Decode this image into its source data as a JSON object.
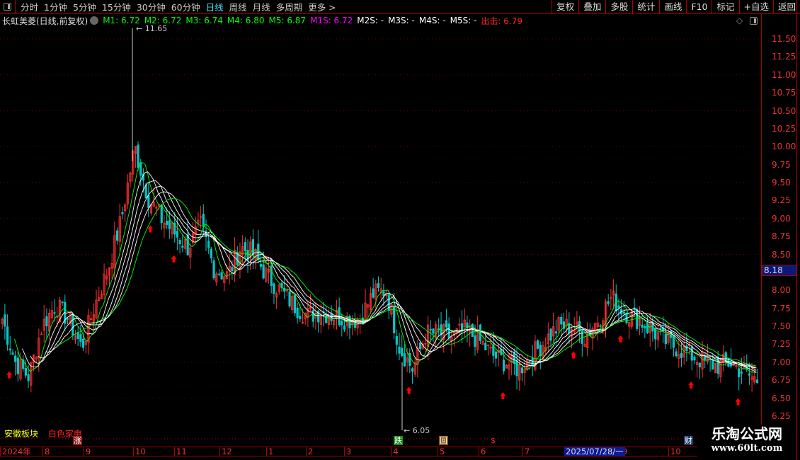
{
  "toolbar": {
    "periods": [
      "分时",
      "1分钟",
      "5分钟",
      "15分钟",
      "30分钟",
      "60分钟",
      "日线",
      "周线",
      "月线",
      "多周期",
      "更多 >"
    ],
    "active": "日线",
    "buttons": [
      "复权",
      "叠加",
      "多股",
      "统计",
      "画线",
      "F10",
      "标记",
      "+自选",
      "返回"
    ]
  },
  "info": {
    "title": "长虹美菱(日线,前复权)",
    "m1": "M1: 6.72",
    "m2": "M2: 6.72",
    "m3": "M3: 6.74",
    "m4": "M4: 6.80",
    "m5": "M5: 6.87",
    "m1s": "M1S: 6.72",
    "m2s": "M2S: -",
    "m3s": "M3S: -",
    "m4s": "M4S: -",
    "m5s": "M5S: -",
    "chuji": "出击: 6.79"
  },
  "price_axis": {
    "ticks": [
      "11.50",
      "11.25",
      "11.00",
      "10.75",
      "10.50",
      "10.25",
      "10.00",
      "9.75",
      "9.50",
      "9.25",
      "9.00",
      "8.75",
      "8.50",
      "8.00",
      "7.75",
      "7.50",
      "7.25",
      "7.00",
      "6.75",
      "6.50",
      "6.25"
    ],
    "current": "8.18"
  },
  "annotations": {
    "high": "11.65",
    "low": "6.05"
  },
  "bottom": {
    "sector": "安徽板块",
    "concept": "白色家电"
  },
  "markers": [
    {
      "text": "涨",
      "color": "#8b1a1a"
    },
    {
      "text": "跌",
      "color": "#1a8a1a"
    },
    {
      "text": "回",
      "color": "#8a5a1a"
    },
    {
      "text": "$",
      "color": "#000"
    },
    {
      "text": "财",
      "color": "#1a3a6a"
    }
  ],
  "time_axis": [
    "2024年",
    "8",
    "9",
    "10",
    "11",
    "12",
    "1",
    "2",
    "3",
    "4",
    "5",
    "6",
    "7",
    "9",
    "10"
  ],
  "selected_date": "2025/07/28/一",
  "colors": {
    "up": "#ff3030",
    "down": "#00c8c8",
    "ma_green": "#00ff00",
    "ma_white": "#ffffff",
    "signal": "#ff0000",
    "accent": "#44ddff"
  },
  "chart_data": {
    "type": "candlestick",
    "price_path": [
      7.6,
      7.0,
      6.8,
      7.5,
      7.8,
      7.6,
      7.2,
      7.8,
      8.3,
      9.0,
      10.0,
      9.3,
      9.0,
      8.8,
      8.6,
      8.9,
      8.3,
      8.2,
      8.6,
      8.5,
      8.2,
      8.0,
      7.8,
      7.65,
      7.7,
      7.65,
      7.6,
      7.6,
      7.95,
      8.0,
      7.2,
      6.9,
      7.4,
      7.4,
      7.35,
      7.45,
      7.3,
      7.1,
      7.0,
      6.9,
      7.1,
      7.3,
      7.5,
      7.5,
      7.35,
      7.6,
      7.9,
      7.7,
      7.6,
      7.45,
      7.3,
      7.2,
      7.1,
      7.0,
      6.95,
      7.0,
      6.85,
      6.75
    ],
    "ylim": [
      6.25,
      11.5
    ]
  },
  "logo": {
    "name": "乐淘公式网",
    "url": "www.60lt.com"
  }
}
